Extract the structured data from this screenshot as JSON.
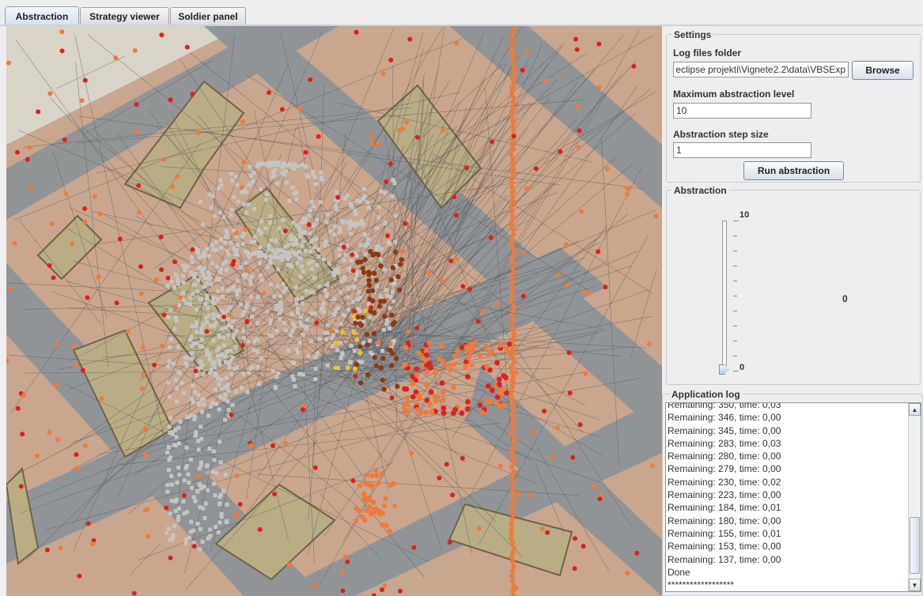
{
  "tabs": [
    {
      "label": "Abstraction",
      "active": true
    },
    {
      "label": "Strategy viewer",
      "active": false
    },
    {
      "label": "Soldier panel",
      "active": false
    }
  ],
  "settings": {
    "legend": "Settings",
    "log_folder_label": "Log files folder",
    "log_folder_value": "eclipse projekti\\Vignete2.2\\data\\VBSExp",
    "browse_label": "Browse",
    "max_level_label": "Maximum abstraction level",
    "max_level_value": "10",
    "step_label": "Abstraction step size",
    "step_value": "1",
    "run_label": "Run abstraction"
  },
  "abstraction": {
    "legend": "Abstraction",
    "slider_max": "10",
    "slider_min": "0",
    "slider_value": 0,
    "current_value": "0"
  },
  "log": {
    "legend": "Application log",
    "lines": [
      "Remaining: 350, time: 0,03",
      "Remaining: 346, time: 0,00",
      "Remaining: 345, time: 0,00",
      "Remaining: 283, time: 0,03",
      "Remaining: 280, time: 0,00",
      "Remaining: 279, time: 0,00",
      "Remaining: 230, time: 0,02",
      "Remaining: 223, time: 0,00",
      "Remaining: 184, time: 0,01",
      "Remaining: 180, time: 0,00",
      "Remaining: 155, time: 0,01",
      "Remaining: 153, time: 0,00",
      "Remaining: 137, time: 0,00",
      "Done",
      "******************"
    ]
  },
  "colors": {
    "ground": "#c9a78e",
    "road": "#8e9497",
    "building": "#b9ad84",
    "grey_points": "#c4c4c4",
    "orange_points": "#f07a3a",
    "red_points": "#e0201a",
    "brown_points": "#8b3a12",
    "yellow_points": "#f0c020"
  },
  "icons": {
    "scroll_up": "triangle-up-icon",
    "scroll_down": "triangle-down-icon",
    "slider_thumb": "slider-thumb-icon"
  }
}
